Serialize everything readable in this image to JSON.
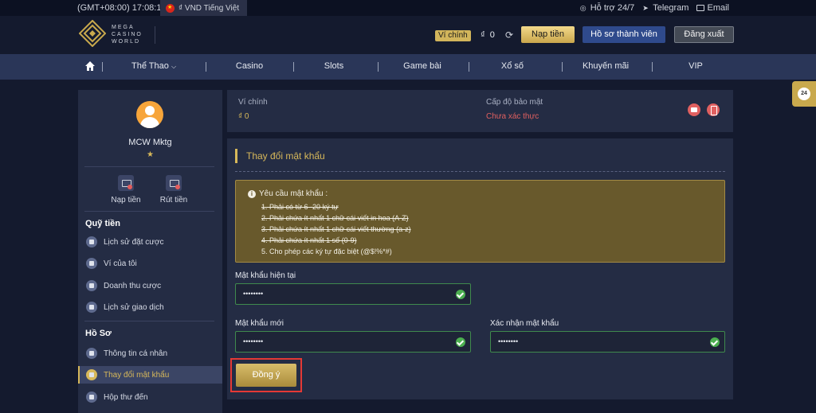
{
  "topbar": {
    "timezone": "(GMT+08:00) 17:08:16",
    "currency_lang": "₫ VND Tiếng Việt",
    "support": "Hỗ trợ 24/7",
    "telegram": "Telegram",
    "email": "Email"
  },
  "header": {
    "logo_lines": [
      "MEGA",
      "CASINO",
      "WORLD"
    ],
    "wallet_tag": "Ví chính",
    "currency": "₫",
    "balance": "0",
    "deposit_btn": "Nạp tiền",
    "profile_btn": "Hồ sơ thành viên",
    "logout_btn": "Đăng xuất"
  },
  "nav": {
    "items": [
      "Thể Thao",
      "Casino",
      "Slots",
      "Game bài",
      "Xổ số",
      "Khuyến mãi",
      "VIP"
    ]
  },
  "float_badge": "24",
  "sidebar": {
    "username": "MCW Mktg",
    "star": "★",
    "deposit": "Nạp tiền",
    "withdraw": "Rút tiền",
    "fund_title": "Quỹ tiền",
    "fund_items": [
      "Lịch sử đặt cược",
      "Ví của tôi",
      "Doanh thu cược",
      "Lịch sử giao dịch"
    ],
    "profile_title": "Hồ Sơ",
    "profile_items": [
      "Thông tin cá nhân",
      "Thay đổi mật khẩu",
      "Hộp thư đến"
    ]
  },
  "wallet_card": {
    "main_label": "Ví chính",
    "main_value": "₫ 0",
    "security_label": "Cấp độ bảo mật",
    "security_value": "Chưa xác thực"
  },
  "panel": {
    "title": "Thay đổi mật khẩu",
    "req_title": "Yêu cầu mật khẩu :",
    "requirements": [
      "1. Phải có từ 6 -20 ký tự",
      "2. Phải chứa ít nhất 1 chữ cái viết in hoa (A-Z)",
      "3. Phải chứa ít nhất 1 chữ cái viết thường (a-z)",
      "4. Phải chứa ít nhất 1 số (0-9)",
      "5. Cho phép các ký tự đặc biệt (@$!%*#)"
    ],
    "current_label": "Mật khẩu hiện tại",
    "current_value": "••••••••",
    "new_label": "Mật khẩu mới",
    "new_value": "••••••••",
    "confirm_label": "Xác nhận mật khẩu",
    "confirm_value": "••••••••",
    "submit_label": "Đồng ý"
  },
  "colors": {
    "gold": "#d7b85a",
    "background": "#141a2e",
    "card": "#242c44",
    "nav": "#2a3658",
    "highlight_red": "#e53935"
  }
}
